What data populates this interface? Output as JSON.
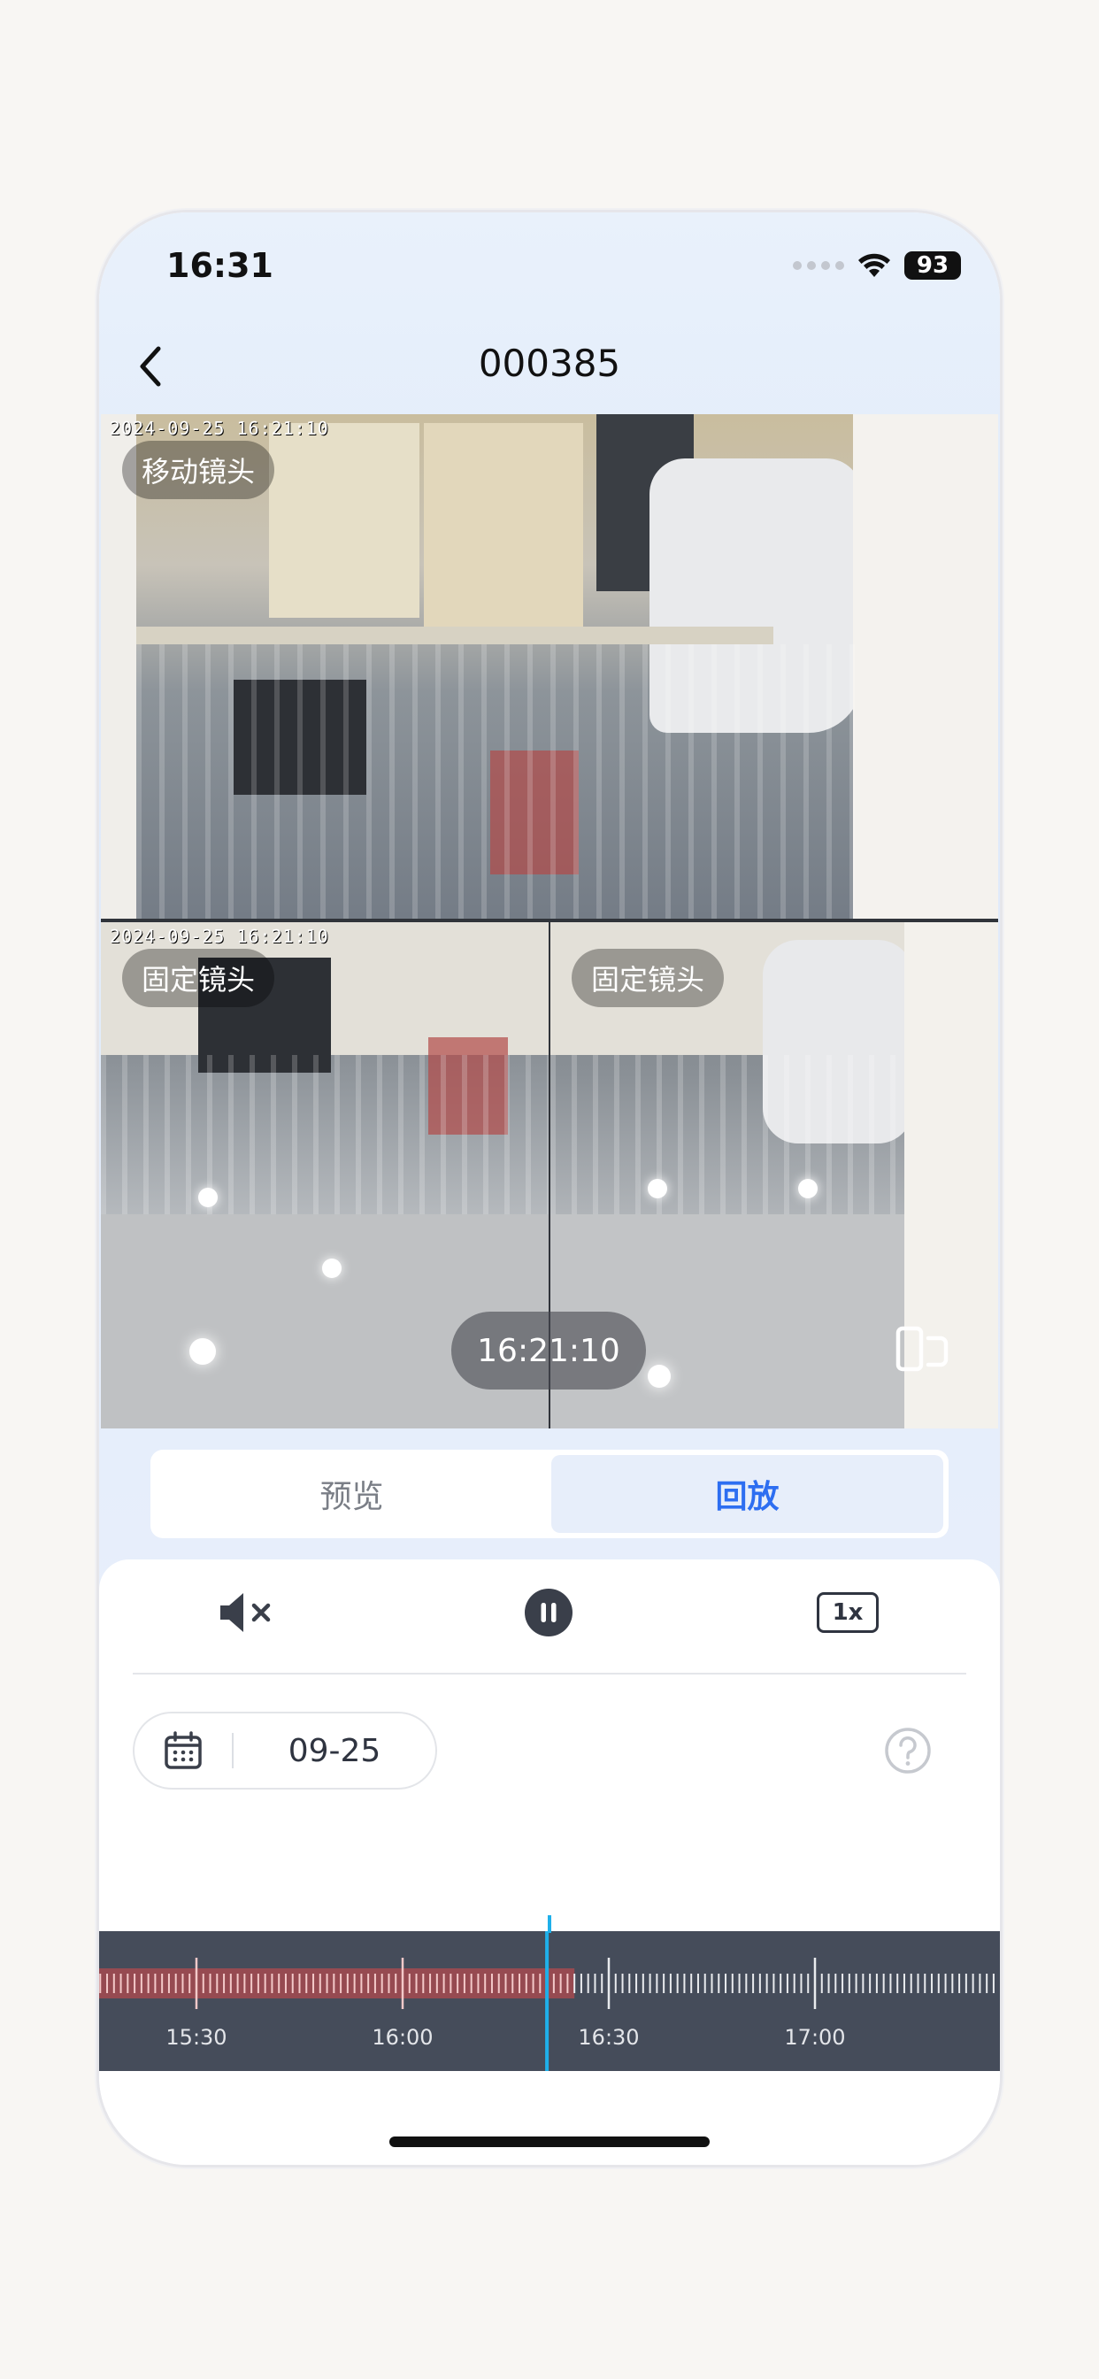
{
  "status_bar": {
    "time": "16:31",
    "battery": "93"
  },
  "nav": {
    "title": "000385"
  },
  "video": {
    "cameras": [
      {
        "label": "移动镜头",
        "osd": "2024-09-25 16:21:10"
      },
      {
        "label": "固定镜头",
        "osd": "2024-09-25 16:21:10"
      },
      {
        "label": "固定镜头"
      }
    ],
    "current_time": "16:21:10"
  },
  "mode_tabs": [
    {
      "label": "预览",
      "active": false
    },
    {
      "label": "回放",
      "active": true
    }
  ],
  "controls": {
    "mute_icon": "speaker-muted-icon",
    "play_state": "paused",
    "speed": "1x"
  },
  "date_picker": {
    "date": "09-25"
  },
  "timeline": {
    "tick_labels": [
      "15:30",
      "16:00",
      "16:30",
      "17:00"
    ],
    "current_time": "16:21",
    "recorded_until": "16:25",
    "accent_color": "#1fb0ea",
    "record_color": "#d9484b"
  },
  "colors": {
    "accent": "#2d6ef1"
  }
}
